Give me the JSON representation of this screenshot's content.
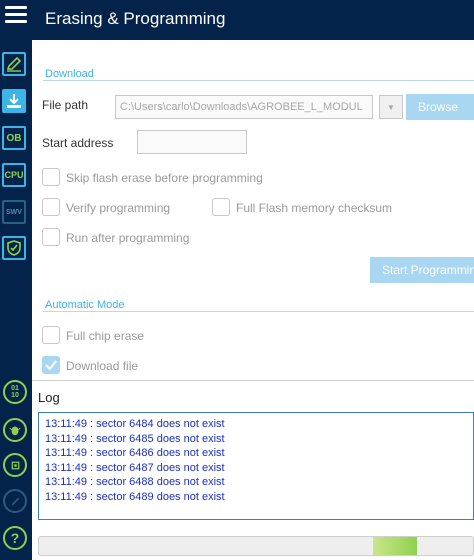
{
  "window": {
    "title": "Erasing & Programming"
  },
  "sidebar": {
    "items": [
      {
        "icon": "pencil-icon"
      },
      {
        "icon": "download-icon"
      },
      {
        "icon": "ob-icon",
        "label": "OB"
      },
      {
        "icon": "cpu-icon",
        "label": "CPU"
      },
      {
        "icon": "swv-icon",
        "label": "SWV"
      },
      {
        "icon": "shield-icon"
      }
    ],
    "bottom_items": [
      {
        "icon": "binary-icon",
        "label": "01\n10"
      },
      {
        "icon": "bug-icon"
      },
      {
        "icon": "chip-icon"
      },
      {
        "icon": "link-icon"
      },
      {
        "icon": "help-icon",
        "label": "?"
      }
    ]
  },
  "download": {
    "section_label": "Download",
    "file_path_label": "File path",
    "file_path_value": "C:\\Users\\carlo\\Downloads\\AGROBEE_L_MODUL",
    "browse_label": "Browse",
    "start_address_label": "Start address",
    "start_address_value": "",
    "skip_erase_label": "Skip flash erase before programming",
    "verify_label": "Verify programming",
    "full_checksum_label": "Full Flash memory checksum",
    "run_after_label": "Run after programming",
    "start_programming_label": "Start Programming"
  },
  "automatic_mode": {
    "section_label": "Automatic Mode",
    "full_chip_erase_label": "Full chip erase",
    "download_file_label": "Download file",
    "download_file_checked": true
  },
  "log": {
    "title": "Log",
    "lines": [
      "13:11:49 : sector 6484 does not exist",
      "13:11:49 : sector 6485 does not exist",
      "13:11:49 : sector 6486 does not exist",
      "13:11:49 : sector 6487 does not exist",
      "13:11:49 : sector 6488 does not exist",
      "13:11:49 : sector 6489 does not exist"
    ]
  },
  "progress": {
    "value_fraction": 0.1,
    "start_fraction": 0.77
  },
  "colors": {
    "navy": "#03234b",
    "accent_blue": "#3cb4e6",
    "accent_green": "#8fd14f",
    "log_text": "#1c2fc4"
  }
}
